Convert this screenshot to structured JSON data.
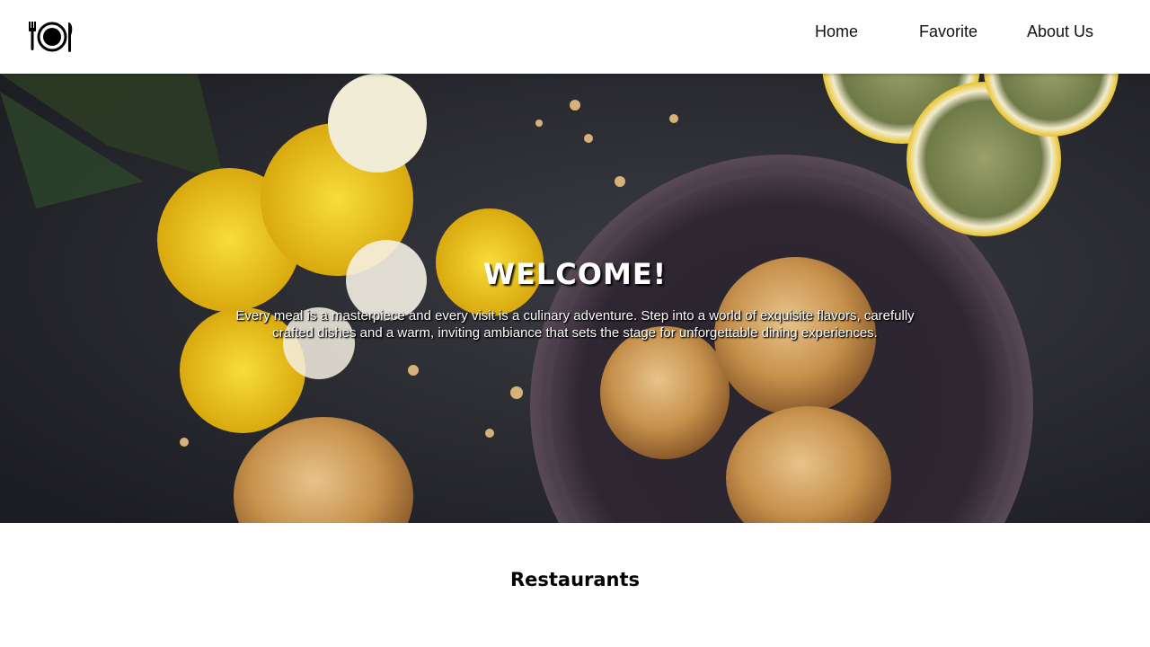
{
  "header": {
    "logo_icon": "plate-fork-knife-icon",
    "nav": {
      "home": "Home",
      "favorite": "Favorite",
      "about": "About Us"
    }
  },
  "hero": {
    "title": "WELCOME!",
    "text": "Every meal is a masterpiece and every visit is a culinary adventure. Step into a world of exquisite flavors, carefully crafted dishes and a warm, inviting ambiance that sets the stage for unforgettable dining experiences."
  },
  "section": {
    "title": "Restaurants"
  },
  "colors": {
    "header_bg": "#ffffff",
    "hero_bg": "#2c2d32",
    "text_on_hero": "#ffffff",
    "accent_yellow": "#f2c81a"
  }
}
